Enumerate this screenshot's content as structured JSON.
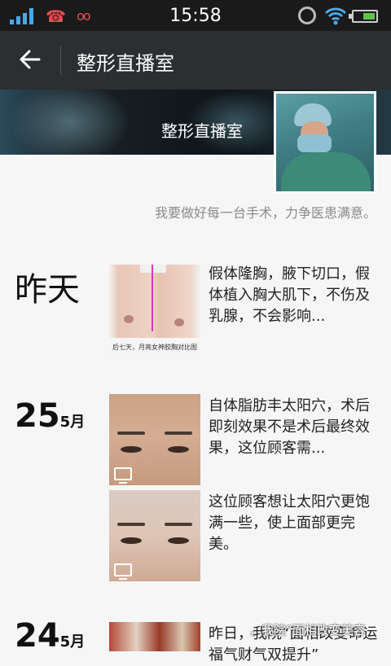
{
  "status_bar": {
    "time": "15:58"
  },
  "app_bar": {
    "title": "整形直播室"
  },
  "profile": {
    "name": "整形直播室",
    "signature": "我要做好每一台手术，力争医患满意。"
  },
  "timeline": {
    "yesterday_label": "昨天",
    "groups": [
      {
        "day": "25",
        "month": "5月"
      },
      {
        "day": "24",
        "month": "5月"
      }
    ],
    "posts": [
      {
        "text": "假体隆胸，腋下切口，假体植入胸大肌下，不伤及乳腺，不会影响...",
        "thumb_caption": "后七天，月亮女神胶胸对比图"
      },
      {
        "text": "自体脂肪丰太阳穴，术后即刻效果不是术后最终效果，这位顾客需..."
      },
      {
        "text": "这位顾客想让太阳穴更饱满一些，使上面部更完美。"
      },
      {
        "text": "昨日，我院“面相改变命运 福气财气双提升”"
      }
    ]
  },
  "watermark": "，我院“面相改变美容"
}
